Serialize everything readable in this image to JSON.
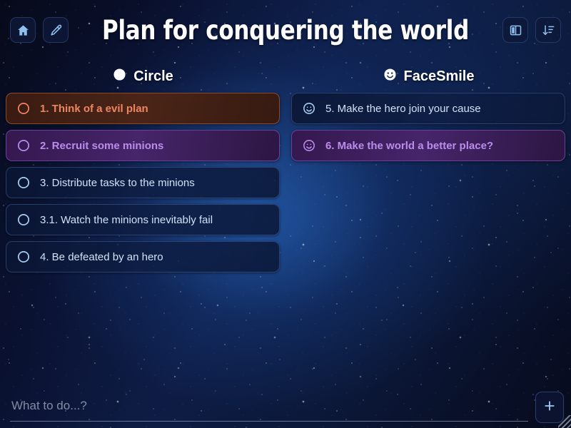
{
  "window": {
    "title": "Plan for conquering the world"
  },
  "header": {
    "title": "Plan for conquering the world",
    "left_buttons": [
      {
        "name": "home-button",
        "icon": "home-icon",
        "label": "Home"
      },
      {
        "name": "edit-button",
        "icon": "pencil-icon",
        "label": "Edit"
      }
    ],
    "right_buttons": [
      {
        "name": "layout-columns-button",
        "icon": "columns-icon",
        "label": "Columns"
      },
      {
        "name": "sort-button",
        "icon": "sort-descending-icon",
        "label": "Sort"
      }
    ]
  },
  "columns": [
    {
      "id": "circle",
      "icon": "circle-filled-icon",
      "label": "Circle",
      "cards": [
        {
          "id": "1",
          "icon": "circle-outline-icon",
          "text": "1. Think of a evil plan",
          "theme": "orange",
          "selected": true
        },
        {
          "id": "2",
          "icon": "circle-outline-icon",
          "text": "2. Recruit some minions",
          "theme": "purple",
          "selected": true
        },
        {
          "id": "3",
          "icon": "circle-outline-icon",
          "text": "3. Distribute tasks to the minions",
          "theme": "plain",
          "selected": false
        },
        {
          "id": "3.1",
          "icon": "circle-outline-icon",
          "text": "3.1. Watch the minions inevitably fail",
          "theme": "plain",
          "selected": false
        },
        {
          "id": "4",
          "icon": "circle-outline-icon",
          "text": "4. Be defeated by an hero",
          "theme": "plain",
          "selected": false
        }
      ]
    },
    {
      "id": "facesmile",
      "icon": "face-smile-icon",
      "label": "FaceSmile",
      "cards": [
        {
          "id": "5",
          "icon": "face-smile-icon",
          "text": "5. Make the hero join your cause",
          "theme": "plain",
          "selected": false
        },
        {
          "id": "6",
          "icon": "face-smile-icon",
          "text": "6. Make the world a better place?",
          "theme": "purple",
          "selected": true
        }
      ]
    }
  ],
  "bottom": {
    "input_placeholder": "What to do...?",
    "input_value": "",
    "add_button_label": "+",
    "add_button_icon": "plus-icon"
  },
  "colors": {
    "accent_orange": "#ef8560",
    "accent_purple": "#bb8cea",
    "card_text": "#cfe2f7",
    "title": "#fdfdfd",
    "background_deep": "#070a1a",
    "background_glow": "#1e56a8"
  }
}
